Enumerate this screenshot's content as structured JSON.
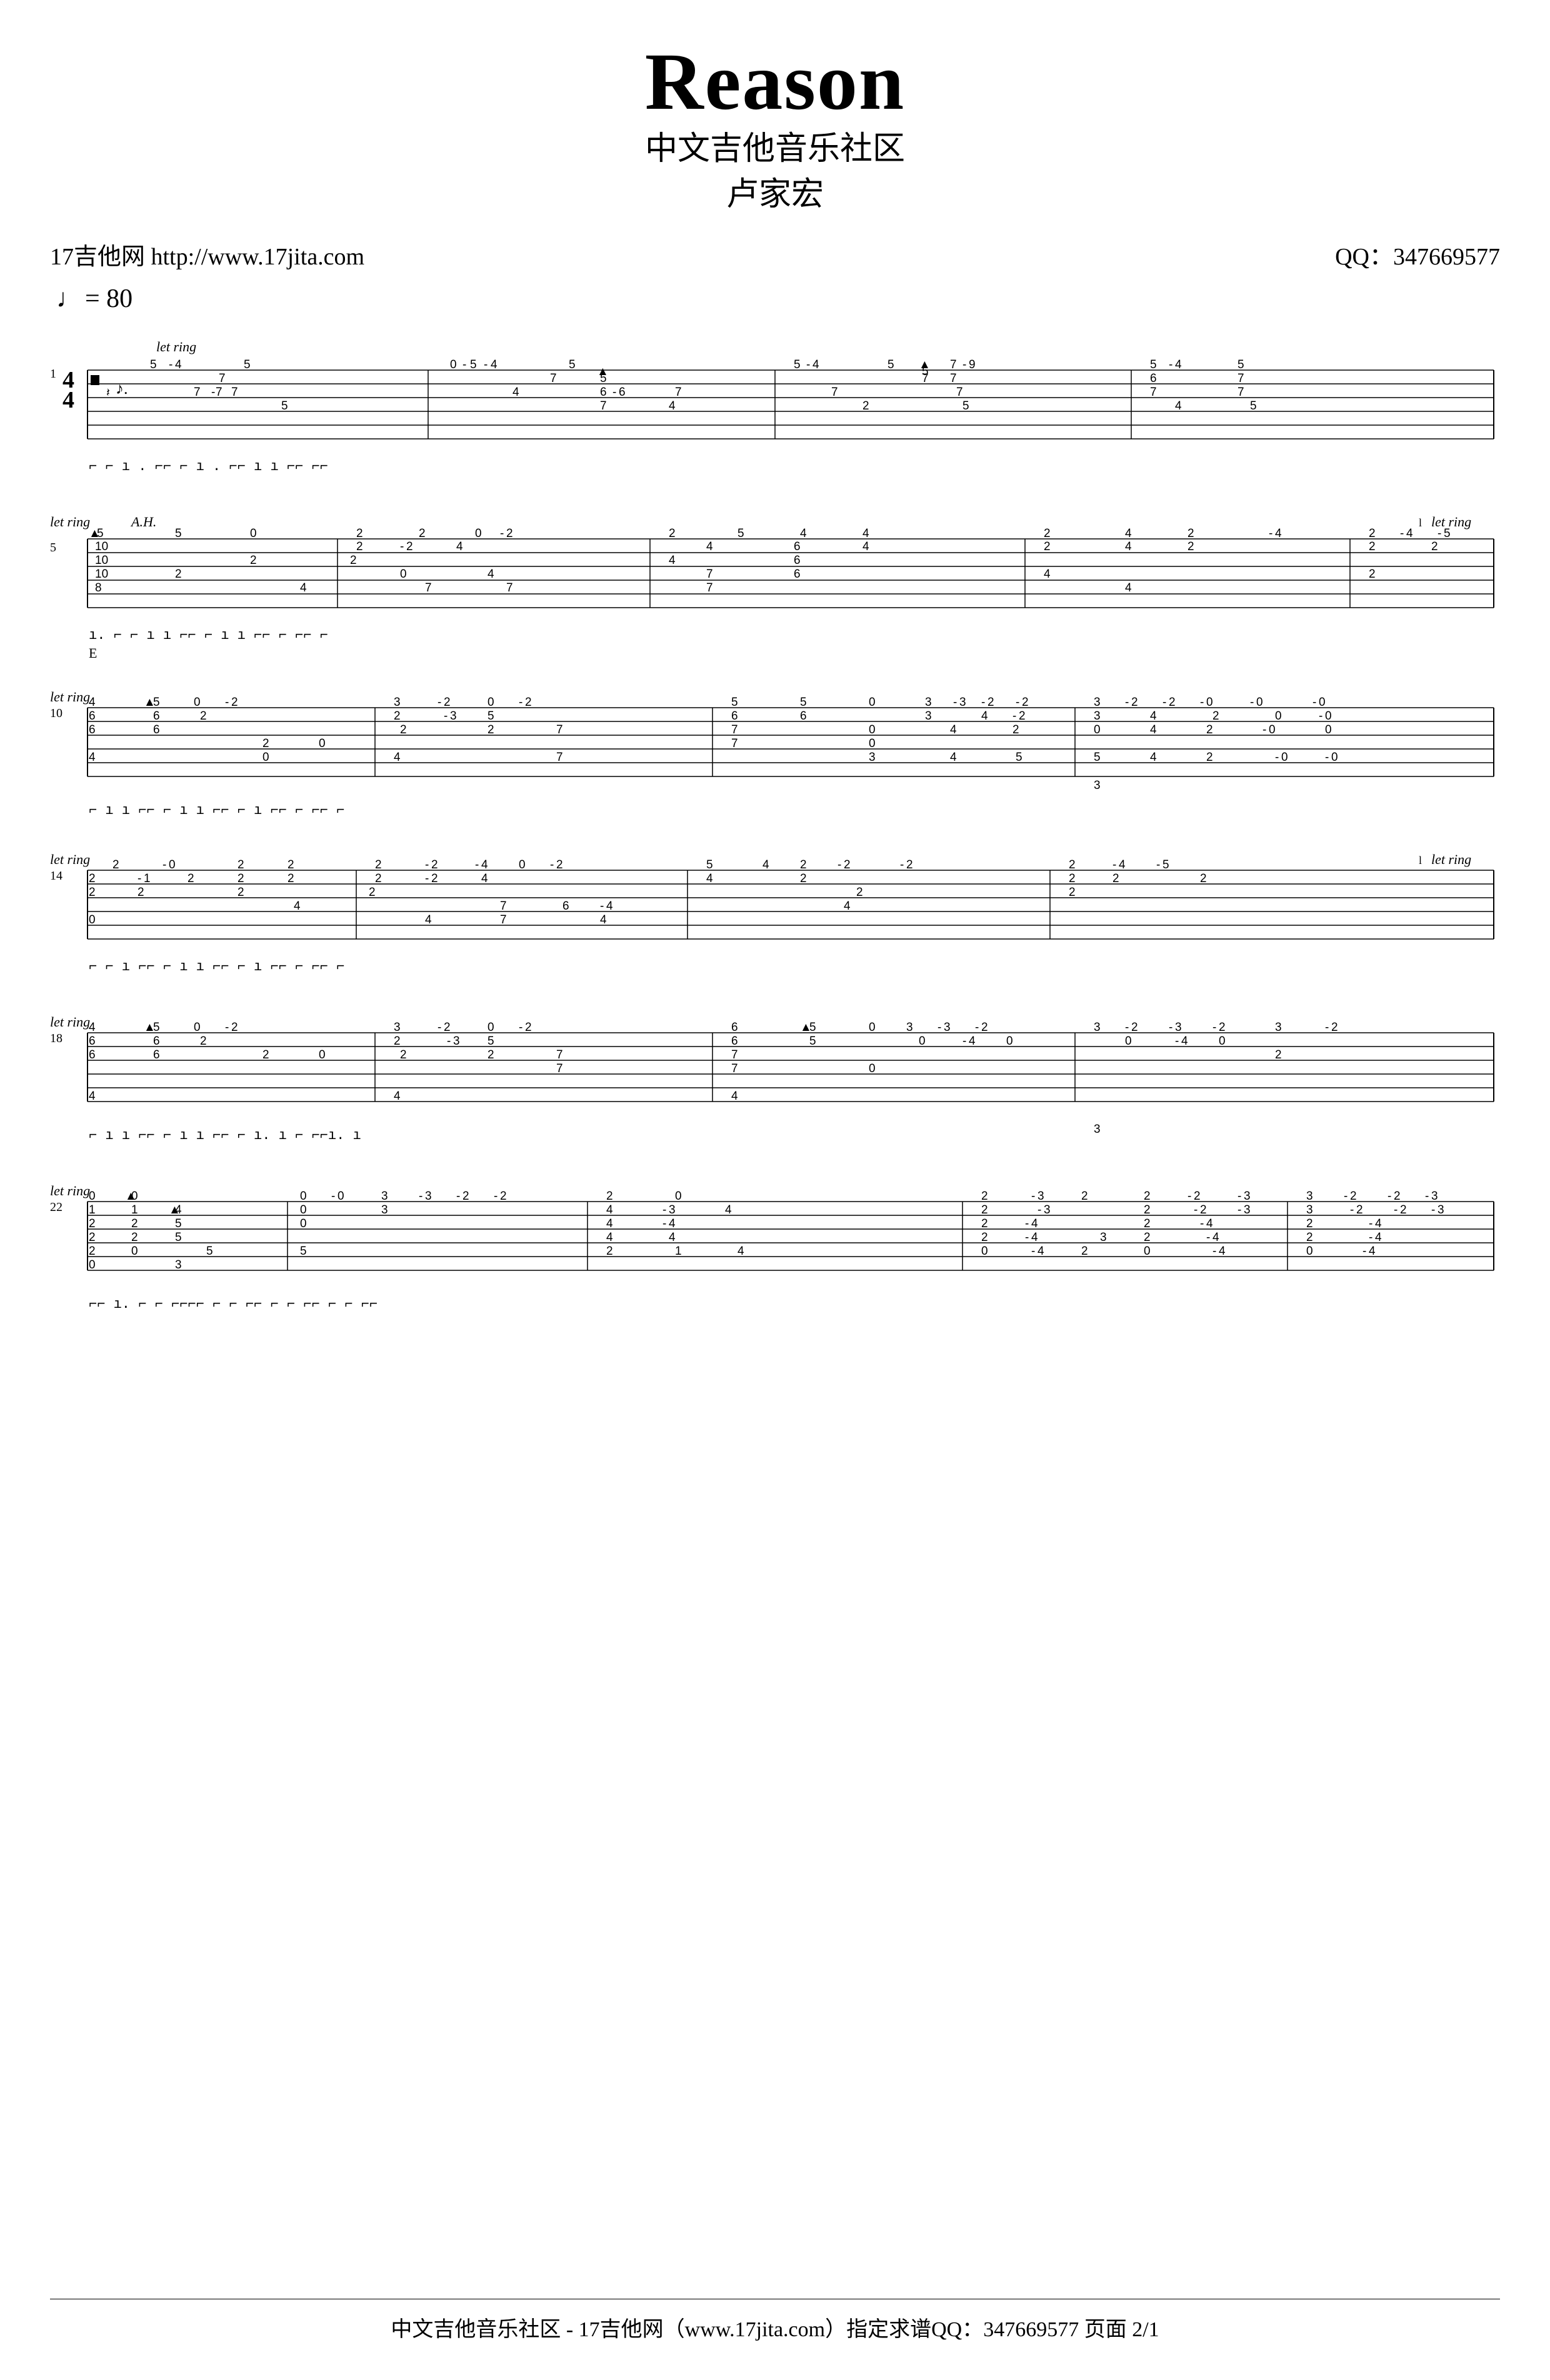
{
  "title": {
    "main": "Reason",
    "sub1": "中文吉他音乐社区",
    "sub2": "卢家宏"
  },
  "header": {
    "left": "17吉他网 http://www.17jita.com",
    "right": "QQ：347669577"
  },
  "tempo": {
    "value": "= 80"
  },
  "footer": "中文吉他音乐社区 - 17吉他网（www.17jita.com）指定求谱QQ：347669577  页面 2/1"
}
